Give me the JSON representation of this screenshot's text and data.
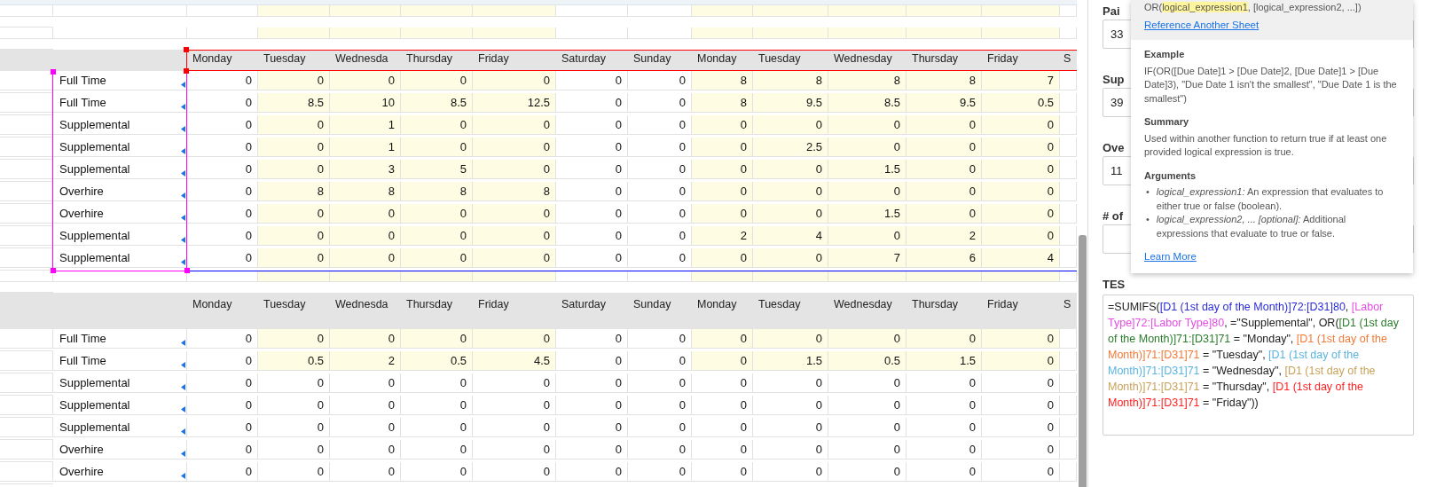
{
  "sheet": {
    "columns": [
      {
        "highlighted": false
      },
      {
        "highlighted": true
      },
      {
        "highlighted": true
      },
      {
        "highlighted": true
      },
      {
        "highlighted": true
      },
      {
        "highlighted": false
      },
      {
        "highlighted": false
      },
      {
        "highlighted": true
      },
      {
        "highlighted": true
      },
      {
        "highlighted": true
      },
      {
        "highlighted": true
      },
      {
        "highlighted": true
      },
      {
        "highlighted": false
      }
    ],
    "blocks": [
      {
        "headers": [
          "Monday",
          "Tuesday",
          "Wednesda",
          "Thursday",
          "Friday",
          "Saturday",
          "Sunday",
          "Monday",
          "Tuesday",
          "Wednesday",
          "Thursday",
          "Friday",
          "S"
        ],
        "tall_header": false,
        "references": [
          {
            "kind": "values",
            "color": "#0000ff"
          },
          {
            "kind": "labor_type",
            "color": "#ff00ff"
          },
          {
            "kind": "header",
            "color": "#ff0000"
          }
        ],
        "rows": [
          {
            "labor_type": "Full Time",
            "highlighted": true,
            "values": [
              "0",
              "0",
              "0",
              "0",
              "0",
              "0",
              "0",
              "8",
              "8",
              "8",
              "8",
              "7"
            ]
          },
          {
            "labor_type": "Full Time",
            "highlighted": true,
            "values": [
              "0",
              "8.5",
              "10",
              "8.5",
              "12.5",
              "0",
              "0",
              "8",
              "9.5",
              "8.5",
              "9.5",
              "0.5"
            ]
          },
          {
            "labor_type": "Supplemental",
            "highlighted": true,
            "values": [
              "0",
              "0",
              "1",
              "0",
              "0",
              "0",
              "0",
              "0",
              "0",
              "0",
              "0",
              "0"
            ]
          },
          {
            "labor_type": "Supplemental",
            "highlighted": true,
            "values": [
              "0",
              "0",
              "1",
              "0",
              "0",
              "0",
              "0",
              "0",
              "2.5",
              "0",
              "0",
              "0"
            ]
          },
          {
            "labor_type": "Supplemental",
            "highlighted": true,
            "values": [
              "0",
              "0",
              "3",
              "5",
              "0",
              "0",
              "0",
              "0",
              "0",
              "1.5",
              "0",
              "0"
            ]
          },
          {
            "labor_type": "Overhire",
            "highlighted": true,
            "values": [
              "0",
              "8",
              "8",
              "8",
              "8",
              "0",
              "0",
              "0",
              "0",
              "0",
              "0",
              "0"
            ]
          },
          {
            "labor_type": "Overhire",
            "highlighted": true,
            "values": [
              "0",
              "0",
              "0",
              "0",
              "0",
              "0",
              "0",
              "0",
              "0",
              "1.5",
              "0",
              "0"
            ]
          },
          {
            "labor_type": "Supplemental",
            "highlighted": true,
            "values": [
              "0",
              "0",
              "0",
              "0",
              "0",
              "0",
              "0",
              "2",
              "4",
              "0",
              "2",
              "0"
            ]
          },
          {
            "labor_type": "Supplemental",
            "highlighted": true,
            "values": [
              "0",
              "0",
              "0",
              "0",
              "0",
              "0",
              "0",
              "0",
              "0",
              "7",
              "6",
              "4"
            ]
          }
        ]
      },
      {
        "headers": [
          "Monday",
          "Tuesday",
          "Wednesda",
          "Thursday",
          "Friday",
          "Saturday",
          "Sunday",
          "Monday",
          "Tuesday",
          "Wednesday",
          "Thursday",
          "Friday",
          "S"
        ],
        "tall_header": true,
        "rows": [
          {
            "labor_type": "Full Time",
            "highlighted": true,
            "values": [
              "0",
              "0",
              "0",
              "0",
              "0",
              "0",
              "0",
              "0",
              "0",
              "0",
              "0",
              "0"
            ]
          },
          {
            "labor_type": "Full Time",
            "highlighted": true,
            "values": [
              "0",
              "0.5",
              "2",
              "0.5",
              "4.5",
              "0",
              "0",
              "0",
              "1.5",
              "0.5",
              "1.5",
              "0"
            ]
          },
          {
            "labor_type": "Supplemental",
            "highlighted": false,
            "values": [
              "0",
              "0",
              "0",
              "0",
              "0",
              "0",
              "0",
              "0",
              "0",
              "0",
              "0",
              "0"
            ]
          },
          {
            "labor_type": "Supplemental",
            "highlighted": false,
            "values": [
              "0",
              "0",
              "0",
              "0",
              "0",
              "0",
              "0",
              "0",
              "0",
              "0",
              "0",
              "0"
            ]
          },
          {
            "labor_type": "Supplemental",
            "highlighted": false,
            "values": [
              "0",
              "0",
              "0",
              "0",
              "0",
              "0",
              "0",
              "0",
              "0",
              "0",
              "0",
              "0"
            ]
          },
          {
            "labor_type": "Overhire",
            "highlighted": false,
            "values": [
              "0",
              "0",
              "0",
              "0",
              "0",
              "0",
              "0",
              "0",
              "0",
              "0",
              "0",
              "0"
            ]
          },
          {
            "labor_type": "Overhire",
            "highlighted": false,
            "values": [
              "0",
              "0",
              "0",
              "0",
              "0",
              "0",
              "0",
              "0",
              "0",
              "0",
              "0",
              "0"
            ]
          }
        ]
      }
    ]
  },
  "panel": {
    "fields": [
      {
        "label": "Pai",
        "value": "33"
      },
      {
        "label": "Sup",
        "value": "39"
      },
      {
        "label": "Ove",
        "value": "11"
      },
      {
        "label": "# of"
      }
    ],
    "formula_label": "TES",
    "formula": [
      {
        "kind": "plain",
        "text": "=SUMIFS("
      },
      {
        "kind": "reference",
        "text": "[D1 (1st day of the Month)]72:[D31]80",
        "color": "#2b2bd9"
      },
      {
        "kind": "plain",
        "text": ", "
      },
      {
        "kind": "reference",
        "text": "[Labor Type]72:[Labor Type]80",
        "color": "#e64ce6"
      },
      {
        "kind": "plain",
        "text": ", =\"Supplemental\", OR("
      },
      {
        "kind": "reference",
        "text": "[D1 (1st day of the Month)]71:[D31]71",
        "color": "#2a7d2a"
      },
      {
        "kind": "plain",
        "text": " = \"Monday\", "
      },
      {
        "kind": "reference",
        "text": "[D1 (1st day of the Month)]71:[D31]71",
        "color": "#f27a38"
      },
      {
        "kind": "plain",
        "text": " = \"Tuesday\", "
      },
      {
        "kind": "reference",
        "text": "[D1 (1st day of the Month)]71:[D31]71",
        "color": "#5ab4e0"
      },
      {
        "kind": "plain",
        "text": " = \"Wednesday\", "
      },
      {
        "kind": "reference",
        "text": "[D1 (1st day of the Month)]71:[D31]71",
        "color": "#c9a25a"
      },
      {
        "kind": "plain",
        "text": " = \"Thursday\", "
      },
      {
        "kind": "reference",
        "text": "[D1 (1st day of the Month)]71:[D31]71",
        "color": "#ff2020"
      },
      {
        "kind": "plain",
        "text": " = \"Friday\"))"
      }
    ]
  },
  "help_popup": {
    "syntax": [
      {
        "text": "OR(",
        "highlighted": false
      },
      {
        "text": "logical_expression1",
        "highlighted": true
      },
      {
        "text": ", [logical_expression2, ...])",
        "highlighted": false
      }
    ],
    "link": "Reference Another Sheet",
    "sections": [
      {
        "kind": "text",
        "heading": "Example",
        "text": "IF(OR([Due Date]1 > [Due Date]2, [Due Date]1 > [Due Date]3), \"Due Date 1 isn't the smallest\", \"Due Date 1 is the smallest\")"
      },
      {
        "kind": "text",
        "heading": "Summary",
        "text": "Used within another function to return true if at least one provided logical expression is true."
      },
      {
        "kind": "list",
        "heading": "Arguments",
        "items": [
          {
            "bullet": "•",
            "text": "*logical_expression1:* An expression that evaluates to either true or false (boolean)."
          },
          {
            "bullet": "•",
            "text": "*logical_expression2, ... [optional]:* Additional expressions that evaluate to true or false."
          }
        ]
      }
    ],
    "learn_more": "Learn More"
  }
}
